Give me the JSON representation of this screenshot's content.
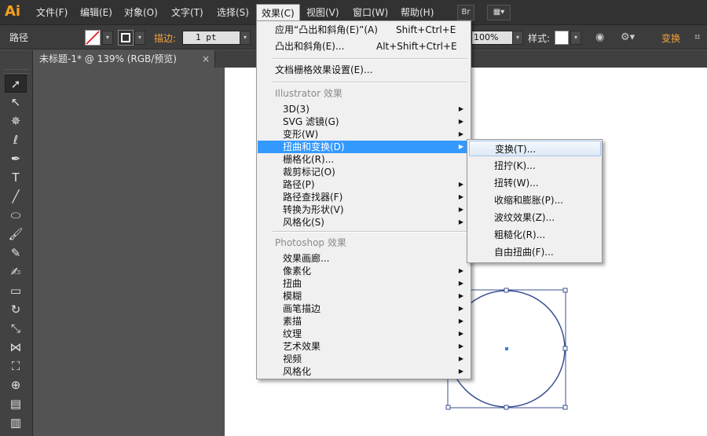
{
  "app": {
    "logo": "Ai"
  },
  "menubar": {
    "items": [
      "文件(F)",
      "编辑(E)",
      "对象(O)",
      "文字(T)",
      "选择(S)",
      "效果(C)",
      "视图(V)",
      "窗口(W)",
      "帮助(H)"
    ],
    "bridge_label": "Br"
  },
  "control": {
    "label": "路径",
    "stroke_label": "描边:",
    "stroke_value": "1 pt",
    "opacity_value": "100%",
    "style_label": "样式:",
    "transform_label": "变换"
  },
  "document": {
    "tab_title": "未标题-1* @ 139% (RGB/预览)",
    "close": "×"
  },
  "effect_menu": {
    "apply": {
      "label": "应用“凸出和斜角(E)”(A)",
      "shortcut": "Shift+Ctrl+E"
    },
    "extrude": {
      "label": "凸出和斜角(E)...",
      "shortcut": "Alt+Shift+Ctrl+E"
    },
    "raster_settings": "文档栅格效果设置(E)...",
    "illustrator_header": "Illustrator 效果",
    "illustrator_items": [
      "3D(3)",
      "SVG 滤镜(G)",
      "变形(W)",
      "扭曲和变换(D)",
      "栅格化(R)...",
      "裁剪标记(O)",
      "路径(P)",
      "路径查找器(F)",
      "转换为形状(V)",
      "风格化(S)"
    ],
    "photoshop_header": "Photoshop 效果",
    "photoshop_items": [
      "效果画廊...",
      "像素化",
      "扭曲",
      "模糊",
      "画笔描边",
      "素描",
      "纹理",
      "艺术效果",
      "视频",
      "风格化"
    ]
  },
  "submenu": {
    "items": [
      "变换(T)...",
      "扭拧(K)...",
      "扭转(W)...",
      "收缩和膨胀(P)...",
      "波纹效果(Z)...",
      "粗糙化(R)...",
      "自由扭曲(F)..."
    ]
  },
  "colors": {
    "highlight": "#3399ff",
    "accent": "#f7a21b",
    "selection": "#3b4f93"
  }
}
